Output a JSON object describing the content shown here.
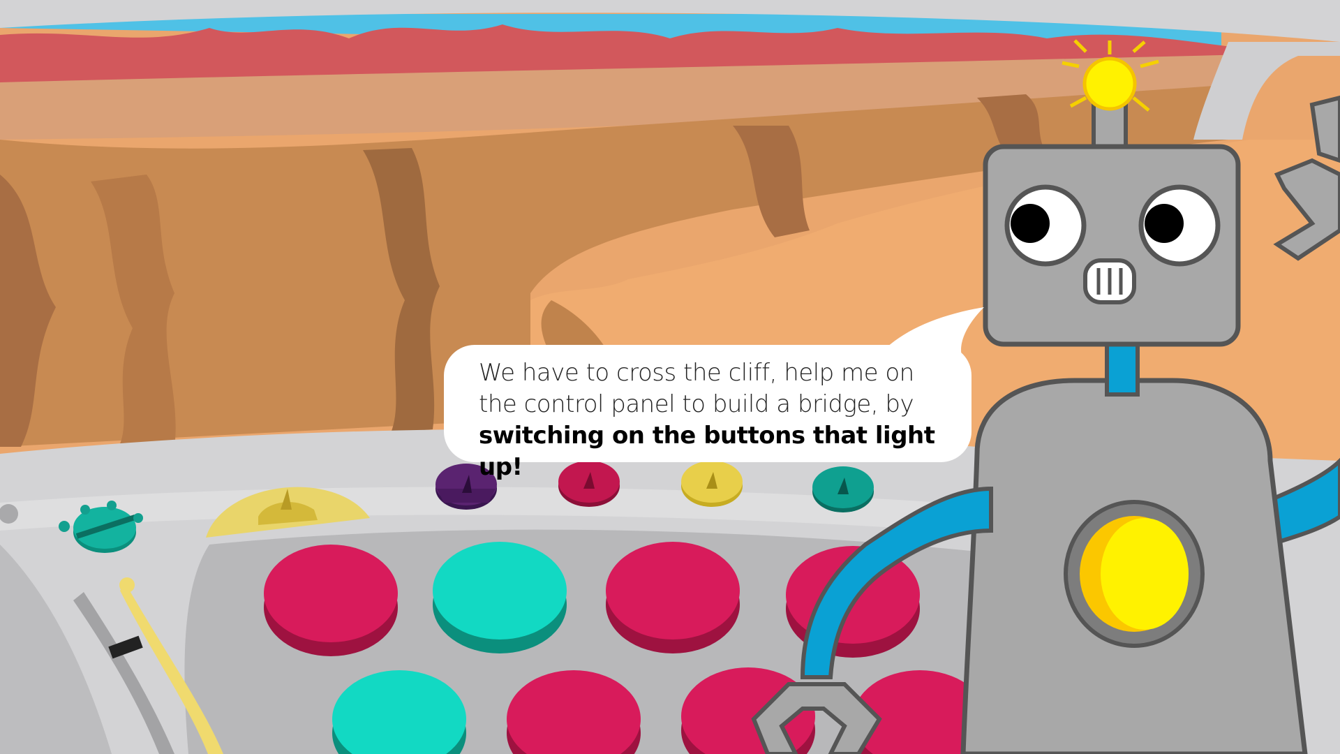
{
  "dialogue": {
    "line1": "We have to cross the cliff, help me on",
    "line2": "the control panel to build a bridge, by",
    "line3": "switching on the buttons that light up!"
  },
  "colors": {
    "sky": "#4fc1e6",
    "mountains": "#d2585c",
    "canyon_light": "#efaa6e",
    "canyon_dark": "#b5774a",
    "dashboard": "#d3d3d5",
    "panel": "#b8b8ba",
    "button_red": "#d81b5b",
    "button_red_edge": "#9e1240",
    "button_teal": "#12d9c3",
    "button_teal_edge": "#0b8f7d",
    "indicator_purple": "#5a2370",
    "indicator_red": "#c2174f",
    "indicator_yellow": "#e8cf4a",
    "indicator_teal": "#0fa090",
    "robot_body": "#a8a8a8",
    "robot_outline": "#555555",
    "robot_arm": "#0aa1d4",
    "robot_light": "#fff200"
  },
  "icons": {
    "antenna": "antenna-bulb-icon",
    "chest": "chest-light-icon"
  }
}
